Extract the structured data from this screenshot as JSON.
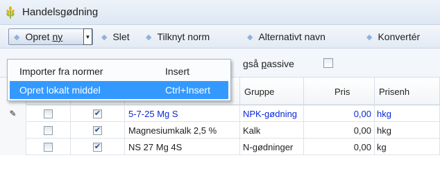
{
  "window": {
    "title": "Handelsgødning",
    "app_icon": "wheat-icon",
    "accent_color": "#3399ff"
  },
  "toolbar": {
    "opret_label": "Opret",
    "opret_underlined": "ny",
    "slet_label": "Slet",
    "tilknyt_label": "Tilknyt norm",
    "alternativt_label": "Alternativt navn",
    "konverter_label": "Konvertér"
  },
  "filter": {
    "label_prefix": "gså ",
    "label_underlined": "p",
    "label_suffix": "assive",
    "checked": false
  },
  "menu": {
    "items": [
      {
        "label": "Importer fra normer",
        "shortcut": "Insert",
        "highlighted": false
      },
      {
        "label": "Opret lokalt middel",
        "shortcut": "Ctrl+Insert",
        "highlighted": true
      }
    ]
  },
  "grid": {
    "columns": {
      "gruppe": "Gruppe",
      "pris": "Pris",
      "prisenhed": "Prisenh"
    },
    "rows": [
      {
        "editing": true,
        "name": "5-7-25 Mg S",
        "gruppe": "NPK-gødning",
        "pris": "0,00",
        "enhed": "hkg",
        "check1": false,
        "check2": true,
        "color": "#0a28d8"
      },
      {
        "editing": false,
        "name": "Magnesiumkalk 2,5 %",
        "gruppe": "Kalk",
        "pris": "0,00",
        "enhed": "hkg",
        "check1": false,
        "check2": true,
        "color": "#1e1e1e"
      },
      {
        "editing": false,
        "name": "NS 27 Mg 4S",
        "gruppe": "N-gødninger",
        "pris": "0,00",
        "enhed": "kg",
        "check1": false,
        "check2": true,
        "color": "#1e1e1e"
      }
    ]
  }
}
